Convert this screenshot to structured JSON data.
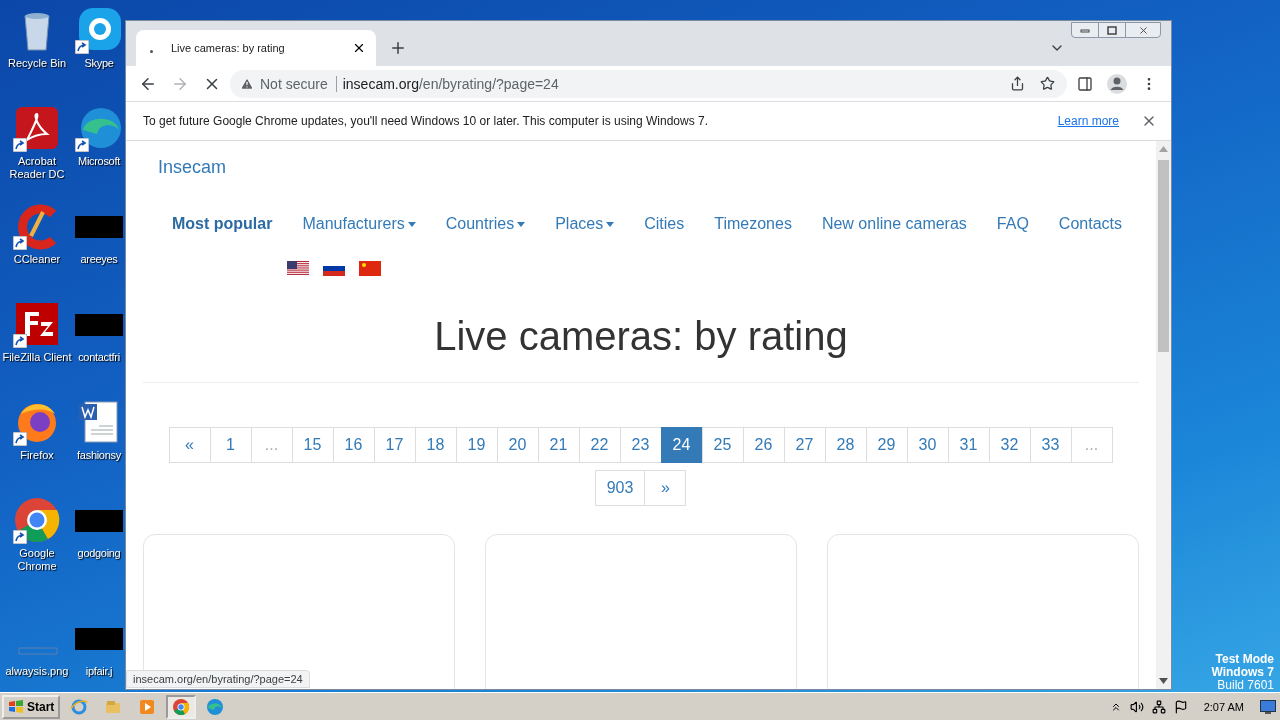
{
  "desktop": {
    "icons": [
      {
        "label": "Recycle Bin",
        "kind": "bin",
        "shortcut": false
      },
      {
        "label": "Skype",
        "kind": "skype",
        "shortcut": true
      },
      {
        "label": "Acrobat Reader DC",
        "kind": "pdf",
        "shortcut": true
      },
      {
        "label": "Microsoft",
        "kind": "edge",
        "shortcut": true
      },
      {
        "label": "CCleaner",
        "kind": "cleaner",
        "shortcut": true
      },
      {
        "label": "areeyes",
        "kind": "thumbnail",
        "shortcut": false
      },
      {
        "label": "FileZilla Client",
        "kind": "ftp",
        "shortcut": true
      },
      {
        "label": "contactfri",
        "kind": "thumbnail",
        "shortcut": false
      },
      {
        "label": "Firefox",
        "kind": "firefox",
        "shortcut": true
      },
      {
        "label": "fashionsy",
        "kind": "document",
        "shortcut": false
      },
      {
        "label": "Google Chrome",
        "kind": "chrome",
        "shortcut": true
      },
      {
        "label": "godgoing",
        "kind": "thumbnail",
        "shortcut": false
      },
      {
        "label": "alwaysis.png",
        "kind": "image",
        "shortcut": false
      },
      {
        "label": "ipfair.j",
        "kind": "thumbnail",
        "shortcut": false
      }
    ],
    "test_mode": [
      "Test Mode",
      "Windows 7",
      "Build 7601"
    ]
  },
  "browser": {
    "tab": {
      "title": "Live cameras: by rating",
      "loading": true
    },
    "address": {
      "security": "Not secure",
      "host": "insecam.org",
      "path": "/en/byrating/?page=24"
    },
    "infobar": {
      "message": "To get future Google Chrome updates, you'll need Windows 10 or later. This computer is using Windows 7.",
      "link": "Learn more"
    },
    "status_url": "insecam.org/en/byrating/?page=24"
  },
  "page": {
    "brand": "Insecam",
    "nav": [
      {
        "label": "Most popular",
        "selected": true,
        "dropdown": false
      },
      {
        "label": "Manufacturers",
        "selected": false,
        "dropdown": true
      },
      {
        "label": "Countries",
        "selected": false,
        "dropdown": true
      },
      {
        "label": "Places",
        "selected": false,
        "dropdown": true
      },
      {
        "label": "Cities",
        "selected": false,
        "dropdown": false
      },
      {
        "label": "Timezones",
        "selected": false,
        "dropdown": false
      },
      {
        "label": "New online cameras",
        "selected": false,
        "dropdown": false
      },
      {
        "label": "FAQ",
        "selected": false,
        "dropdown": false
      },
      {
        "label": "Contacts",
        "selected": false,
        "dropdown": false
      }
    ],
    "languages": [
      {
        "kind": "us"
      },
      {
        "kind": "ru"
      },
      {
        "kind": "cn"
      }
    ],
    "heading": "Live cameras: by rating",
    "pagination": [
      {
        "label": "«",
        "selected": false,
        "disabled": false
      },
      {
        "label": "1",
        "selected": false,
        "disabled": false
      },
      {
        "label": "...",
        "selected": false,
        "disabled": true
      },
      {
        "label": "15",
        "selected": false,
        "disabled": false
      },
      {
        "label": "16",
        "selected": false,
        "disabled": false
      },
      {
        "label": "17",
        "selected": false,
        "disabled": false
      },
      {
        "label": "18",
        "selected": false,
        "disabled": false
      },
      {
        "label": "19",
        "selected": false,
        "disabled": false
      },
      {
        "label": "20",
        "selected": false,
        "disabled": false
      },
      {
        "label": "21",
        "selected": false,
        "disabled": false
      },
      {
        "label": "22",
        "selected": false,
        "disabled": false
      },
      {
        "label": "23",
        "selected": false,
        "disabled": false
      },
      {
        "label": "24",
        "selected": true,
        "disabled": false
      },
      {
        "label": "25",
        "selected": false,
        "disabled": false
      },
      {
        "label": "26",
        "selected": false,
        "disabled": false
      },
      {
        "label": "27",
        "selected": false,
        "disabled": false
      },
      {
        "label": "28",
        "selected": false,
        "disabled": false
      },
      {
        "label": "29",
        "selected": false,
        "disabled": false
      },
      {
        "label": "30",
        "selected": false,
        "disabled": false
      },
      {
        "label": "31",
        "selected": false,
        "disabled": false
      },
      {
        "label": "32",
        "selected": false,
        "disabled": false
      },
      {
        "label": "33",
        "selected": false,
        "disabled": false
      },
      {
        "label": "...",
        "selected": false,
        "disabled": true
      },
      {
        "label": "903",
        "selected": false,
        "disabled": false
      },
      {
        "label": "»",
        "selected": false,
        "disabled": false
      }
    ],
    "camera_cards": [
      {
        "kind": "empty"
      },
      {
        "kind": "empty"
      },
      {
        "kind": "empty"
      }
    ]
  },
  "taskbar": {
    "start": "Start",
    "apps": [
      {
        "kind": "ie",
        "active": false
      },
      {
        "kind": "folder",
        "active": false
      },
      {
        "kind": "media",
        "active": false
      },
      {
        "kind": "chrome",
        "active": true
      },
      {
        "kind": "edge",
        "active": false
      }
    ],
    "clock": "2:07 AM"
  }
}
